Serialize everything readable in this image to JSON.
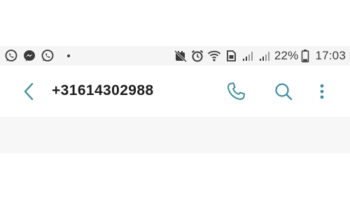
{
  "status_bar": {
    "left_icons": [
      "whatsapp-icon",
      "messenger-icon",
      "whatsapp-icon",
      "notification-dot"
    ],
    "right_icons": [
      "do-not-disturb-icon",
      "alarm-icon",
      "wifi-icon",
      "sim-icon",
      "signal-icon",
      "signal-icon"
    ],
    "battery_percent": "22%",
    "battery_level": 0.22,
    "time": "17:03"
  },
  "app_bar": {
    "back_icon": "chevron-left-icon",
    "title": "+31614302988",
    "actions": [
      "phone-icon",
      "search-icon",
      "more-vert-icon"
    ]
  },
  "colors": {
    "accent": "#3f8f9f",
    "status_text": "#3a3a3a",
    "title_text": "#1d1d1d",
    "statusbar_bg": "#f5f5f5",
    "content_bg": "#f7f7f7"
  }
}
